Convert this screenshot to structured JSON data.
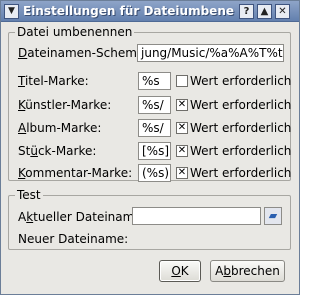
{
  "window": {
    "title": "Einstellungen für Dateiumbenennung"
  },
  "rename_group": {
    "title": "Datei umbenennen",
    "schema": {
      "label_underlined": "D",
      "label_rest": "ateinamen-Schema:",
      "value": "jung/Music/%a%A%T%t%c"
    },
    "rows": [
      {
        "pre": "",
        "u": "T",
        "post": "itel-Marke:",
        "value": "%s",
        "checked": false,
        "check_glyph": "",
        "check_label": "Wert erforderlich"
      },
      {
        "pre": "",
        "u": "K",
        "post": "ünstler-Marke:",
        "value": "%s/",
        "checked": true,
        "check_glyph": "✕",
        "check_label": "Wert erforderlich"
      },
      {
        "pre": "",
        "u": "A",
        "post": "lbum-Marke:",
        "value": "%s/",
        "checked": true,
        "check_glyph": "✕",
        "check_label": "Wert erforderlich"
      },
      {
        "pre": "St",
        "u": "ü",
        "post": "ck-Marke:",
        "value": "[%s]",
        "checked": true,
        "check_glyph": "✕",
        "check_label": "Wert erforderlich"
      },
      {
        "pre": "",
        "u": "K",
        "post": "ommentar-Marke:",
        "value": "(%s)",
        "checked": true,
        "check_glyph": "✕",
        "check_label": "Wert erforderlich"
      }
    ]
  },
  "test_group": {
    "title": "Test",
    "current": {
      "pre": "A",
      "u": "k",
      "post": "tueller Dateiname:",
      "value": ""
    },
    "new_label": "Neuer Dateiname:",
    "new_value": ""
  },
  "buttons": {
    "ok": {
      "u": "O",
      "post": "K"
    },
    "cancel": {
      "pre": "A",
      "u": "b",
      "post": "brechen"
    }
  },
  "colors": {
    "titlebar": "#7390bb",
    "window_bg": "#e9e8e4"
  }
}
